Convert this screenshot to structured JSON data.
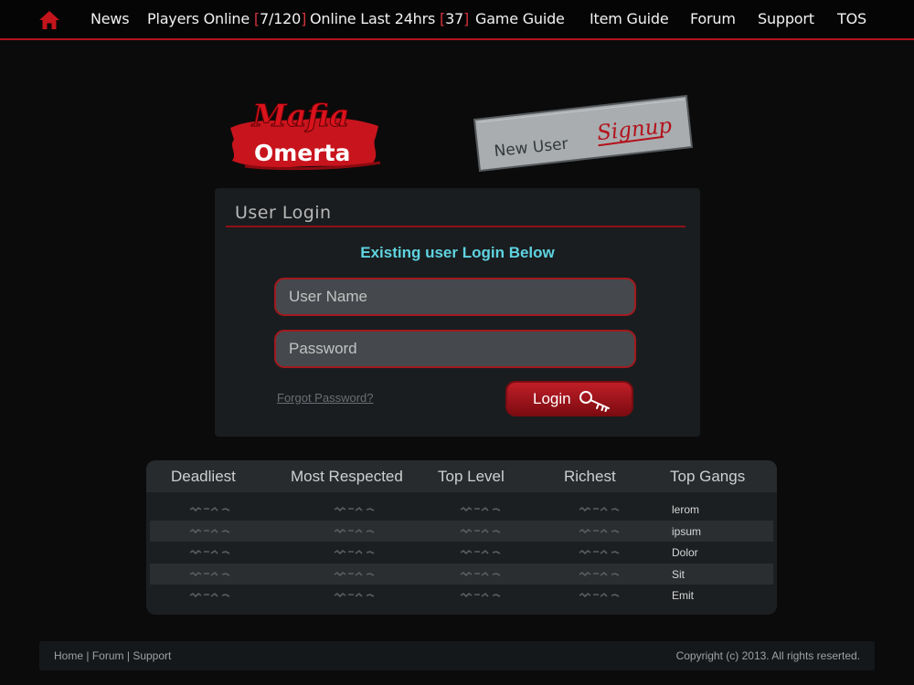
{
  "nav": {
    "home_icon": "home-icon",
    "items": [
      {
        "label": "News"
      },
      {
        "label": "Players Online",
        "open": "[",
        "count": "7/120",
        "close": "]"
      },
      {
        "label": "Online Last 24hrs",
        "open": "[",
        "count": "37",
        "close": "]"
      },
      {
        "label": "Game Guide"
      },
      {
        "label": "Item Guide"
      },
      {
        "label": "Forum"
      },
      {
        "label": "Support"
      },
      {
        "label": "TOS"
      }
    ]
  },
  "logo": {
    "line1": "Mafia",
    "line2": "Omerta"
  },
  "signup": {
    "prefix": "New User",
    "action": "Signup"
  },
  "login": {
    "title": "User Login",
    "subtitle": "Existing user Login Below",
    "username_placeholder": "User Name",
    "password_placeholder": "Password",
    "forgot_label": "Forgot Password?",
    "button_label": "Login"
  },
  "leaderboard": {
    "headers": [
      "Deadliest",
      "Most Respected",
      "Top Level",
      "Richest",
      "Top Gangs"
    ],
    "gangs": [
      "lerom",
      "ipsum",
      "Dolor",
      "Sit",
      "Emit"
    ]
  },
  "footer": {
    "links": [
      "Home",
      "Forum",
      "Support"
    ],
    "separator": "|",
    "copyright": "Copyright (c) 2013. All rights reserted."
  },
  "colors": {
    "accent": "#b3121b",
    "highlight": "#5fd3e0",
    "background": "#0b0b0b"
  }
}
